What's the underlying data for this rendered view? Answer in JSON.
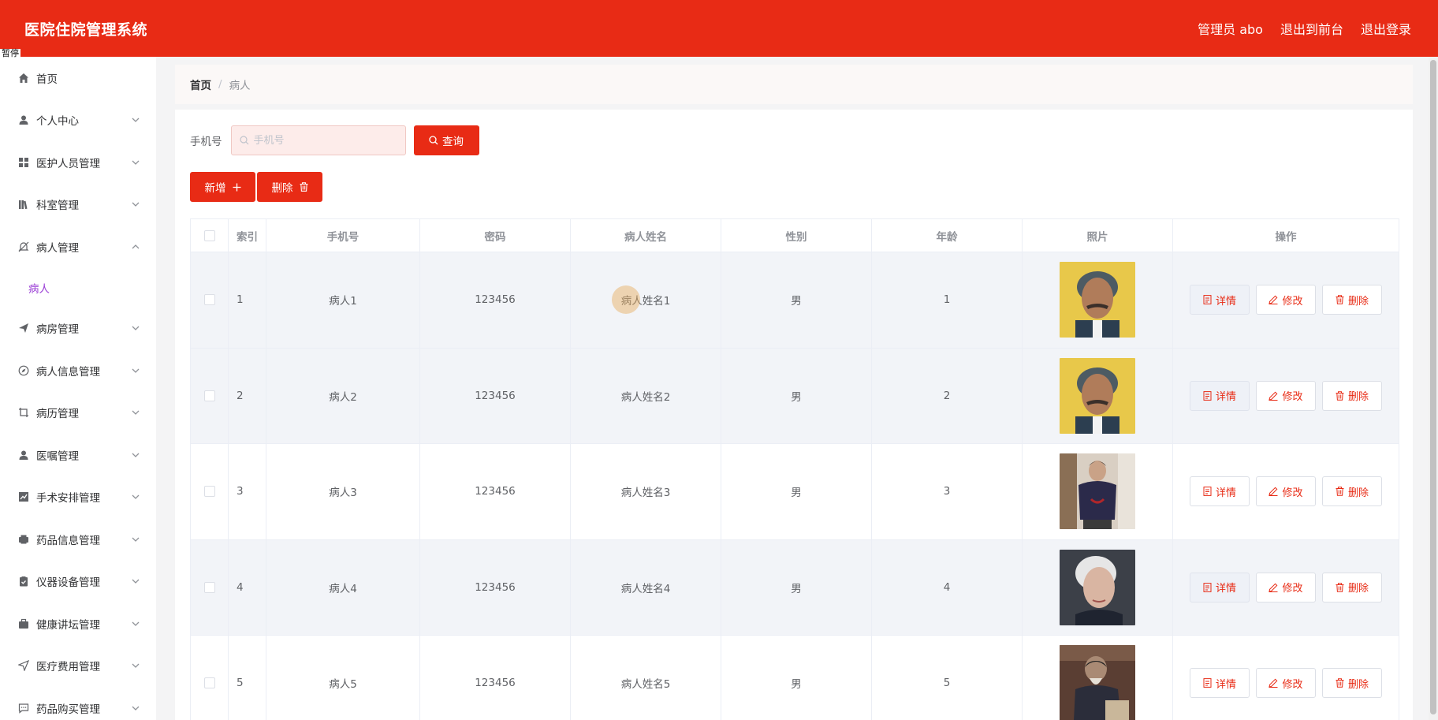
{
  "app": {
    "title": "医院住院管理系统"
  },
  "header": {
    "user": "管理员 abo",
    "front": "退出到前台",
    "logout": "退出登录"
  },
  "overlay": {
    "tag": "暂停"
  },
  "sidebar": {
    "items": [
      {
        "label": "首页",
        "icon": "home-icon",
        "has_arrow": false
      },
      {
        "label": "个人中心",
        "icon": "user-icon",
        "has_arrow": true
      },
      {
        "label": "医护人员管理",
        "icon": "grid-icon",
        "has_arrow": true
      },
      {
        "label": "科室管理",
        "icon": "library-icon",
        "has_arrow": true
      },
      {
        "label": "病人管理",
        "icon": "bell-off-icon",
        "has_arrow": true,
        "expanded": true
      },
      {
        "label": "病房管理",
        "icon": "send-icon",
        "has_arrow": true
      },
      {
        "label": "病人信息管理",
        "icon": "compass-icon",
        "has_arrow": true
      },
      {
        "label": "病历管理",
        "icon": "crop-icon",
        "has_arrow": true
      },
      {
        "label": "医嘱管理",
        "icon": "user-icon",
        "has_arrow": true
      },
      {
        "label": "手术安排管理",
        "icon": "chart-icon",
        "has_arrow": true
      },
      {
        "label": "药品信息管理",
        "icon": "printer-icon",
        "has_arrow": true
      },
      {
        "label": "仪器设备管理",
        "icon": "clipboard-icon",
        "has_arrow": true
      },
      {
        "label": "健康讲坛管理",
        "icon": "briefcase-icon",
        "has_arrow": true
      },
      {
        "label": "医疗费用管理",
        "icon": "location-icon",
        "has_arrow": true
      },
      {
        "label": "药品购买管理",
        "icon": "chat-icon",
        "has_arrow": true
      }
    ],
    "submenu": {
      "label": "病人"
    }
  },
  "breadcrumb": {
    "home": "首页",
    "separator": "/",
    "current": "病人"
  },
  "search": {
    "label": "手机号",
    "placeholder": "手机号",
    "button": "查询"
  },
  "actions": {
    "add": "新增",
    "delete": "删除"
  },
  "table": {
    "columns": [
      "索引",
      "手机号",
      "密码",
      "病人姓名",
      "性别",
      "年龄",
      "照片",
      "操作"
    ],
    "rows": [
      {
        "index": "1",
        "phone": "病人1",
        "password": "123456",
        "name": "病人姓名1",
        "gender": "男",
        "age": "1",
        "photo": "elderly-man-yellow"
      },
      {
        "index": "2",
        "phone": "病人2",
        "password": "123456",
        "name": "病人姓名2",
        "gender": "男",
        "age": "2",
        "photo": "elderly-man-yellow"
      },
      {
        "index": "3",
        "phone": "病人3",
        "password": "123456",
        "name": "病人姓名3",
        "gender": "男",
        "age": "3",
        "photo": "elderly-woman-seated"
      },
      {
        "index": "4",
        "phone": "病人4",
        "password": "123456",
        "name": "病人姓名4",
        "gender": "男",
        "age": "4",
        "photo": "elderly-woman-gray"
      },
      {
        "index": "5",
        "phone": "病人5",
        "password": "123456",
        "name": "病人姓名5",
        "gender": "男",
        "age": "5",
        "photo": "elderly-man-dark"
      }
    ],
    "ops": {
      "detail": "详情",
      "edit": "修改",
      "delete": "删除"
    }
  },
  "colors": {
    "primary": "#e82b15",
    "submenu_active": "#9b3fd6",
    "zebra": "#f2f4f8"
  }
}
